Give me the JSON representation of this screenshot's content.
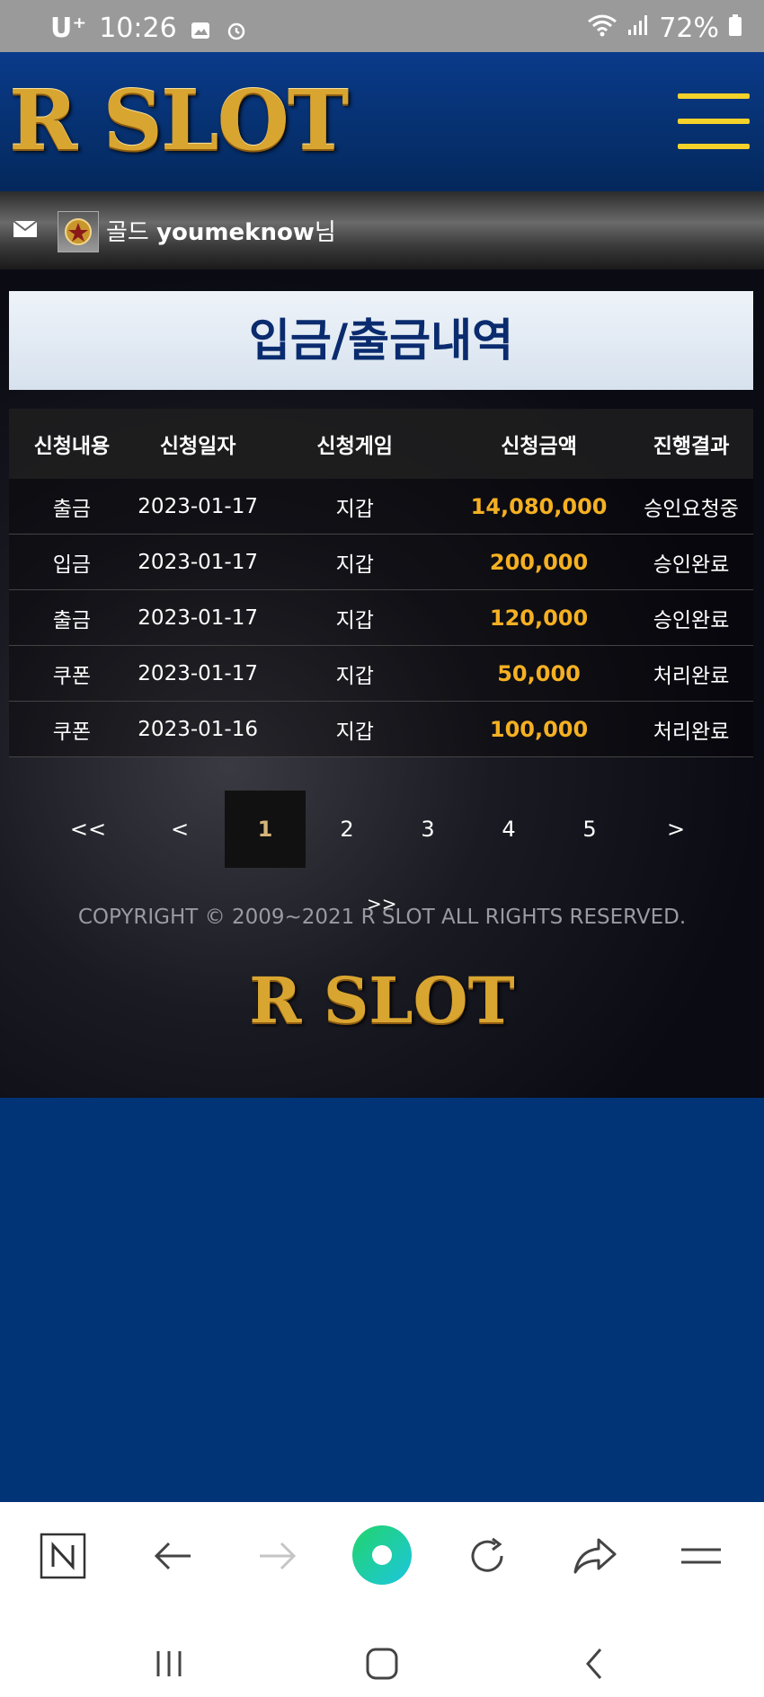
{
  "status": {
    "carrier": "U⁺",
    "time": "10:26",
    "battery": "72%"
  },
  "header": {
    "logo": "R SLOT"
  },
  "user": {
    "rank": "골드",
    "username": "youmeknow",
    "suffix": "님"
  },
  "page": {
    "title": "입금/출금내역"
  },
  "table": {
    "headers": [
      "신청내용",
      "신청일자",
      "신청게임",
      "신청금액",
      "진행결과"
    ],
    "rows": [
      {
        "type": "출금",
        "date": "2023-01-17",
        "game": "지갑",
        "amount": "14,080,000",
        "result": "승인요청중"
      },
      {
        "type": "입금",
        "date": "2023-01-17",
        "game": "지갑",
        "amount": "200,000",
        "result": "승인완료"
      },
      {
        "type": "출금",
        "date": "2023-01-17",
        "game": "지갑",
        "amount": "120,000",
        "result": "승인완료"
      },
      {
        "type": "쿠폰",
        "date": "2023-01-17",
        "game": "지갑",
        "amount": "50,000",
        "result": "처리완료"
      },
      {
        "type": "쿠폰",
        "date": "2023-01-16",
        "game": "지갑",
        "amount": "100,000",
        "result": "처리완료"
      }
    ]
  },
  "pagination": {
    "first": "<<",
    "prev": "<",
    "pages": [
      "1",
      "2",
      "3",
      "4",
      "5"
    ],
    "next": ">",
    "last": ">>",
    "current": "1"
  },
  "footer": {
    "copyright": "COPYRIGHT © 2009~2021 R SLOT ALL RIGHTS RESERVED.",
    "logo": "R SLOT"
  },
  "colors": {
    "amount": "#f5b022",
    "brand_blue": "#013476",
    "gold": "#d9a531",
    "menu_yellow": "#f5d22a"
  },
  "icons": {
    "browser": [
      "naver-n-icon",
      "back-arrow-icon",
      "forward-arrow-icon",
      "home-circle-icon",
      "refresh-icon",
      "share-icon",
      "menu-icon"
    ],
    "system": [
      "recent-apps-icon",
      "home-icon",
      "back-icon"
    ]
  }
}
